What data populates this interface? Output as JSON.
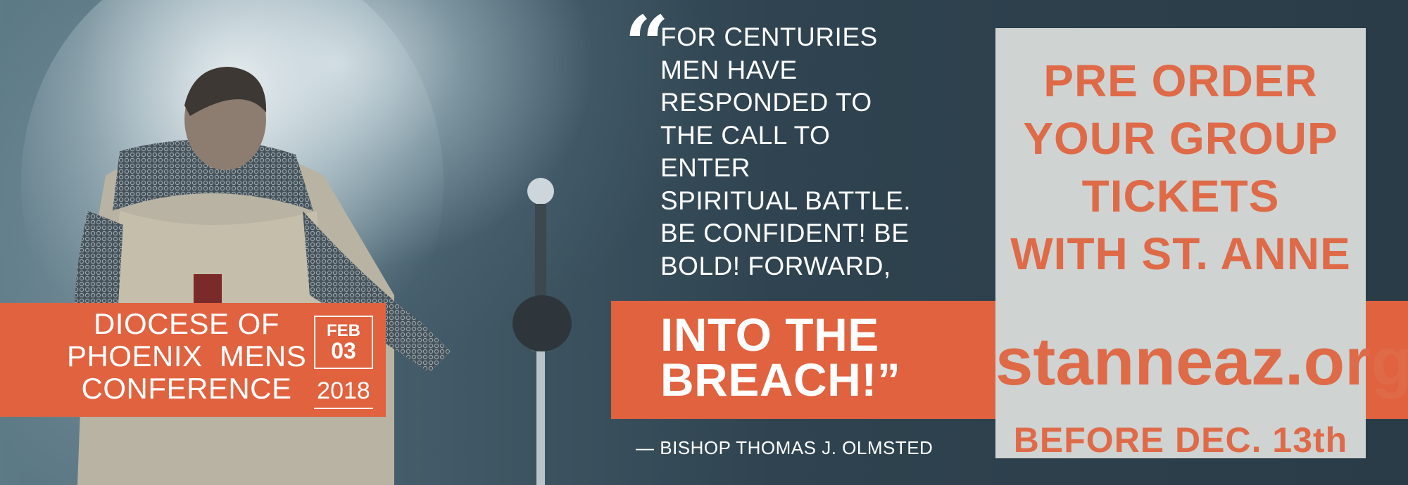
{
  "conference": {
    "name_lines": [
      "DIOCESE OF",
      "PHOENIX  MENS",
      "CONFERENCE"
    ],
    "month": "FEB",
    "day": "03",
    "year": "2018"
  },
  "quote": {
    "mark": "“",
    "lines": [
      "FOR CENTURIES",
      "MEN HAVE",
      "RESPONDED TO",
      "THE CALL TO",
      "ENTER",
      "SPIRITUAL BATTLE.",
      "BE CONFIDENT! BE",
      "BOLD! FORWARD,"
    ],
    "emphasis_lines": [
      "INTO THE",
      "BREACH!”"
    ],
    "attribution": "— BISHOP THOMAS J. OLMSTED"
  },
  "promo": {
    "lines": [
      "PRE ORDER",
      "YOUR GROUP",
      "TICKETS",
      "WITH ST. ANNE"
    ],
    "url": "stanneaz.org",
    "deadline": "BEFORE DEC. 13th"
  },
  "colors": {
    "accent": "#e0623f",
    "promo_text": "#df6a48",
    "promo_bg": "#cfd3d2",
    "background": "#2b3d48"
  },
  "images": {
    "hero": "kneeling-knight-with-sword"
  }
}
